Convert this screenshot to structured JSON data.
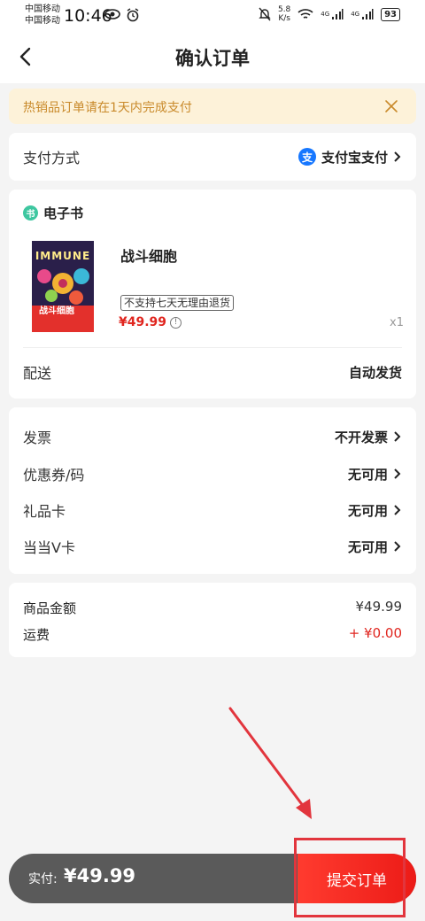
{
  "status_bar": {
    "carrier_1": "中国移动",
    "carrier_2": "中国移动",
    "time": "10:46",
    "speed_value": "5.8",
    "speed_unit": "K/s",
    "signal_1": "4G",
    "signal_2": "4G",
    "battery": "93"
  },
  "nav": {
    "title": "确认订单"
  },
  "notice": {
    "text": "热销品订单请在1天内完成支付"
  },
  "payment": {
    "label": "支付方式",
    "alipay_glyph": "支",
    "value": "支付宝支付"
  },
  "order": {
    "section_label": "电子书",
    "section_glyph": "书",
    "book_title": "战斗细胞",
    "cover_title": "IMMUNE",
    "cover_cn": "战斗细胞",
    "tag": "不支持七天无理由退货",
    "price": "¥49.99",
    "qty": "x1",
    "delivery_label": "配送",
    "delivery_value": "自动发货"
  },
  "options": [
    {
      "label": "发票",
      "value": "不开发票"
    },
    {
      "label": "优惠券/码",
      "value": "无可用"
    },
    {
      "label": "礼品卡",
      "value": "无可用"
    },
    {
      "label": "当当V卡",
      "value": "无可用"
    }
  ],
  "amounts": {
    "goods_label": "商品金额",
    "goods_value": "¥49.99",
    "shipping_label": "运费",
    "shipping_value": "+ ¥0.00"
  },
  "footer": {
    "pay_label": "实付:",
    "pay_amount": "¥49.99",
    "submit_label": "提交订单"
  },
  "colors": {
    "accent": "#e0261f",
    "notice_bg": "#fdf2d9",
    "notice_text": "#c98a2b",
    "alipay": "#1677ff",
    "annotation": "#e2353d"
  }
}
